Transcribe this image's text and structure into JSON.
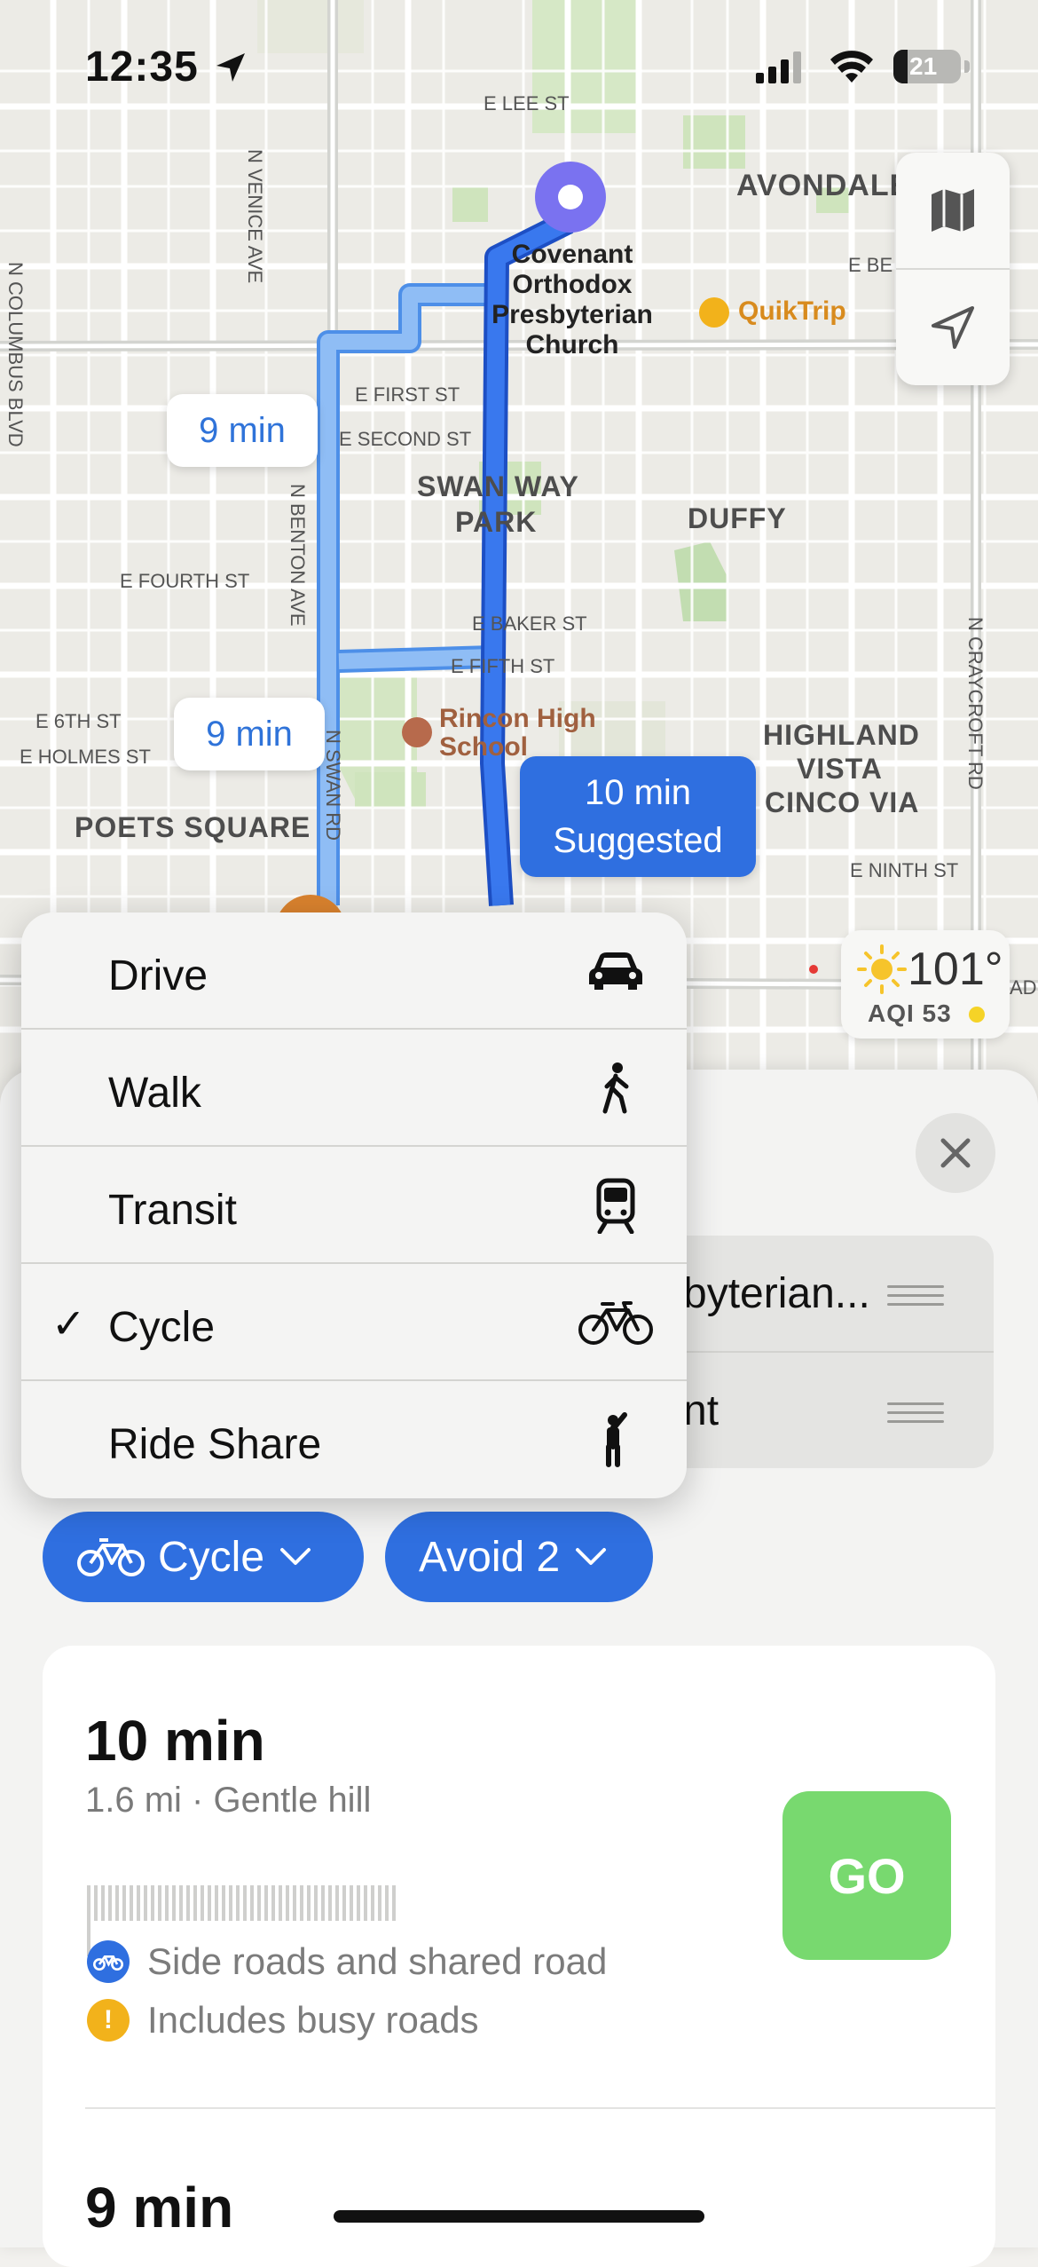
{
  "status_bar": {
    "time": "12:35",
    "battery_level": "21"
  },
  "map": {
    "street_labels": [
      "E LEE ST",
      "N VENICE AVE",
      "N COLUMBUS BLVD",
      "E FIRST ST",
      "E SECOND ST",
      "E FOURTH ST",
      "N BENTON AVE",
      "E BAKER ST",
      "E FIFTH ST",
      "E 6TH ST",
      "E HOLMES ST",
      "N SWAN RD",
      "E NINTH ST",
      "N CRAYCROFT RD",
      "E BE",
      "AD"
    ],
    "area_labels": [
      "AVONDALE",
      "SWAN WAY",
      "PARK",
      "DUFFY",
      "HIGHLAND",
      "VISTA",
      "CINCO VIA",
      "POETS SQUARE"
    ],
    "destination_name": [
      "Covenant",
      "Orthodox",
      "Presbyterian",
      "Church"
    ],
    "poi_quiktrip": "QuikTrip",
    "poi_school": [
      "Rincon High",
      "School"
    ],
    "route_bubbles": {
      "alt1": "9 min",
      "alt2": "9 min",
      "suggested_time": "10 min",
      "suggested_label": "Suggested"
    },
    "weather": {
      "temperature": "101°",
      "aqi": "AQI 53"
    }
  },
  "stops": {
    "destination_partial": "byterian...",
    "origin_partial": "nt"
  },
  "mode_menu": {
    "items": [
      {
        "label": "Drive",
        "icon": "car-icon",
        "selected": false
      },
      {
        "label": "Walk",
        "icon": "walking-person-icon",
        "selected": false
      },
      {
        "label": "Transit",
        "icon": "tram-icon",
        "selected": false
      },
      {
        "label": "Cycle",
        "icon": "bicycle-icon",
        "selected": true
      },
      {
        "label": "Ride Share",
        "icon": "hailing-person-icon",
        "selected": false
      }
    ],
    "checkmark": "✓"
  },
  "chips": {
    "mode_label": "Cycle",
    "avoid_label": "Avoid 2"
  },
  "routes": [
    {
      "time": "10 min",
      "summary": "1.6 mi · Gentle hill",
      "notes": [
        "Side roads and shared road",
        "Includes busy roads"
      ],
      "go_label": "GO"
    },
    {
      "time": "9 min"
    }
  ],
  "colors": {
    "accent_blue": "#2f6fe0",
    "route_light": "#7fb2f3",
    "go_green": "#78d96f",
    "warning_yellow": "#f2b21b",
    "destination_purple": "#7a72f0"
  }
}
